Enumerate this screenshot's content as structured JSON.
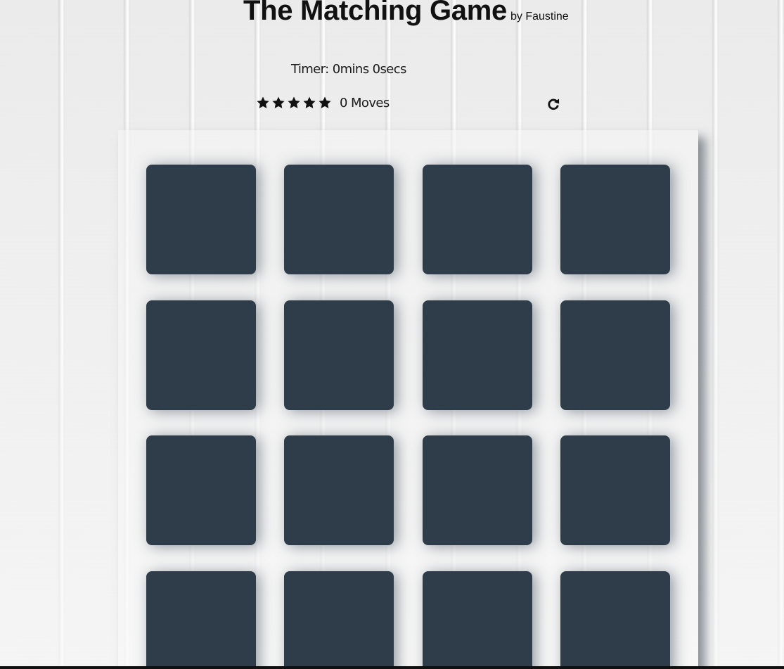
{
  "header": {
    "title": "The Matching Game",
    "byline": "by Faustine"
  },
  "timer": {
    "text": "Timer: 0mins 0secs"
  },
  "score_panel": {
    "stars": [
      "star-icon",
      "star-icon",
      "star-icon",
      "star-icon",
      "star-icon"
    ],
    "moves_text": "0 Moves",
    "restart_icon": "restart-icon"
  },
  "deck": {
    "rows": 4,
    "cols": 4,
    "card_state": "face-down"
  },
  "colors": {
    "card_back": "#2e3d49",
    "text": "#111111",
    "background": "#ececec"
  }
}
